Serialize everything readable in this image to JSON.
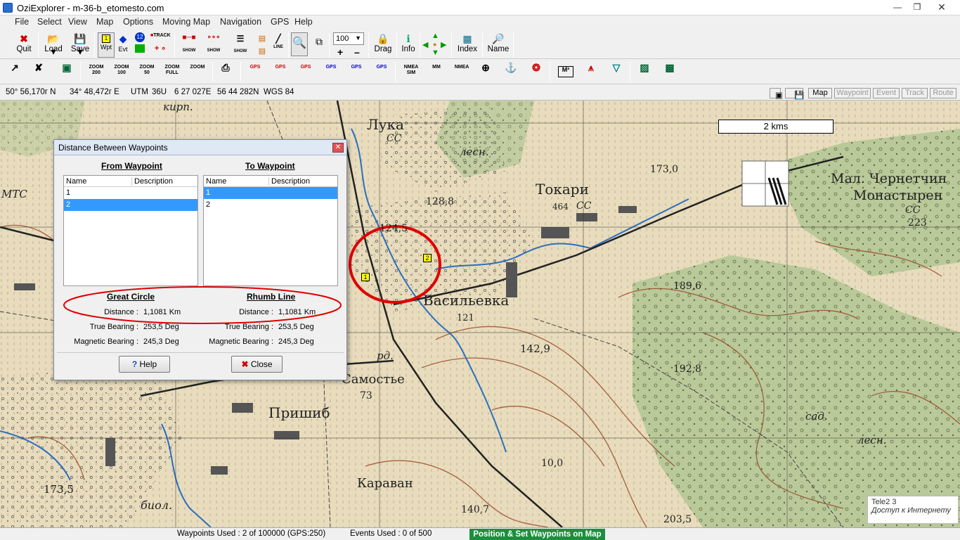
{
  "window": {
    "title": "OziExplorer - m-36-b_etomesto.com"
  },
  "menu": [
    "File",
    "Select",
    "View",
    "Map",
    "Options",
    "Moving Map",
    "Navigation",
    "GPS",
    "Help"
  ],
  "toolbar1": {
    "quit": "Quit",
    "load": "Load",
    "save": "Save",
    "wpt": "Wpt",
    "evt": "Evt",
    "track_tag": "TRACK",
    "show1": "SHOW",
    "show2": "SHOW",
    "show3": "SHOW",
    "line_tag": "LINE",
    "zoom_value": "100",
    "drag": "Drag",
    "info": "Info",
    "index": "Index",
    "name": "Name"
  },
  "toolbar2": {
    "zoom200": "ZOOM 200",
    "zoom100": "ZOOM 100",
    "zoom50": "ZOOM 50",
    "zoomfull": "ZOOM FULL",
    "zoom": "ZOOM",
    "gps": "GPS",
    "nmea_sim": "NMEA SIM",
    "mm": "MM",
    "nmea": "NMEA",
    "m2": "M²"
  },
  "coords": {
    "lat": "50° 56,170г N",
    "lon": "34° 48,472г E",
    "utm": "UTM",
    "zone": "36U",
    "easting": "6 27 027E",
    "northing": "56 44 282N",
    "datum": "WGS 84"
  },
  "map_tabs": [
    "Map",
    "Waypoint",
    "Event",
    "Track",
    "Route"
  ],
  "map": {
    "scale": "2 kms",
    "labels": [
      "Лука",
      "СС",
      "лесн.",
      "Токари",
      "СС",
      "464",
      "Мал. Чернетчин",
      "Монастырен",
      "СС",
      "223",
      "173,0",
      "128,8",
      "124,5",
      "Васильевка",
      "121",
      "189,6",
      "142,9",
      "192,8",
      "Самостье",
      "73",
      "Пришиб",
      "173,5",
      "Караван",
      "140,7",
      "10,0",
      "203,5",
      "биол.",
      "МТС",
      "кирп.",
      "рд.",
      "лесн.",
      "сад."
    ],
    "waypoints": [
      "1",
      "2"
    ]
  },
  "dialog": {
    "title": "Distance Between Waypoints",
    "from_header": "From Waypoint",
    "to_header": "To Waypoint",
    "col_name": "Name",
    "col_desc": "Description",
    "from_rows": [
      "1",
      "2"
    ],
    "to_rows": [
      "1",
      "2"
    ],
    "great_circle": "Great Circle",
    "rhumb_line": "Rhumb Line",
    "distance_label": "Distance :",
    "true_bearing_label": "True Bearing :",
    "magnetic_bearing_label": "Magnetic Bearing :",
    "gc_distance": "1,1081 Km",
    "gc_true": "253,5 Deg",
    "gc_magnetic": "245,3 Deg",
    "rl_distance": "1,1081 Km",
    "rl_true": "253,5 Deg",
    "rl_magnetic": "245,3 Deg",
    "help": "Help",
    "close": "Close"
  },
  "status": {
    "waypoints": "Waypoints Used : 2 of 100000  (GPS:250)",
    "events": "Events Used : 0 of 500",
    "mode": "Position & Set Waypoints on Map"
  },
  "tray": {
    "line1": "Tele2  3",
    "line2": "Доступ к Интернету"
  },
  "colors": {
    "highlight": "#3399ff",
    "status_green": "#1e8e3e",
    "annotation_red": "#e00000"
  }
}
